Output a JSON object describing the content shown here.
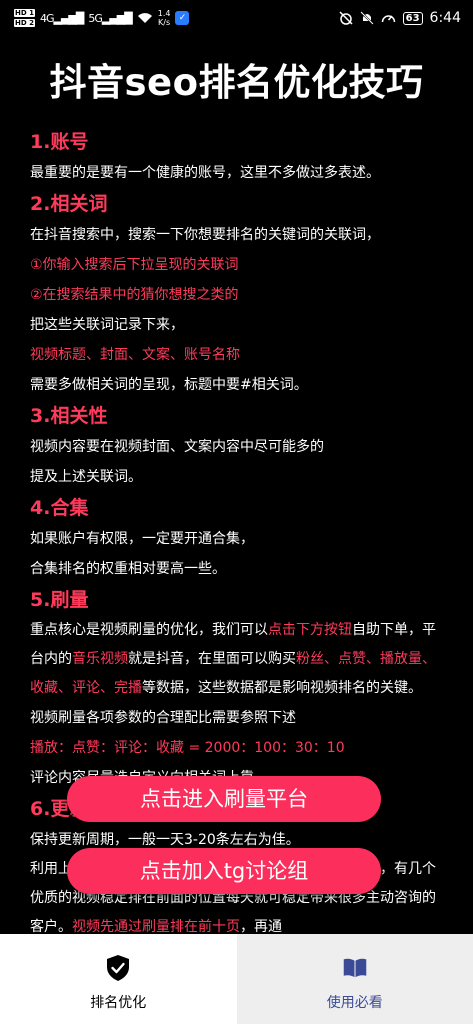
{
  "status_bar": {
    "sim1": "HD 1",
    "sim2": "HD 2",
    "net1": "4G",
    "net2": "5G",
    "speed_value": "1.4",
    "speed_unit": "K/s",
    "battery": "63",
    "time": "6:44"
  },
  "title": "抖音seo排名优化技巧",
  "sections": {
    "s1": {
      "heading": "1.账号",
      "p1": "最重要的是要有一个健康的账号，这里不多做过多表述。"
    },
    "s2": {
      "heading": "2.相关词",
      "p1": "在抖音搜索中，搜索一下你想要排名的关键词的关联词，",
      "p2": "①你输入搜索后下拉呈现的关联词",
      "p3": "②在搜索结果中的猜你想搜之类的",
      "p4": "把这些关联词记录下来，",
      "p5": "视频标题、封面、文案、账号名称",
      "p6": "需要多做相关词的呈现，标题中要#相关词。"
    },
    "s3": {
      "heading": "3.相关性",
      "p1": "视频内容要在视频封面、文案内容中尽可能多的",
      "p2": "提及上述关联词。"
    },
    "s4": {
      "heading": "4.合集",
      "p1": "如果账户有权限，一定要开通合集，",
      "p2": "合集排名的权重相对要高一些。"
    },
    "s5": {
      "heading": "5.刷量",
      "t1": "重点核心是视频刷量的优化，我们可以",
      "t2": "点击下方按钮",
      "t3": "自助下单，平台内的",
      "t4": "音乐视频",
      "t5": "就是抖音，在里面可以购买",
      "t6": "粉丝、点赞、播放量、收藏、评论、完播",
      "t7": "等数据，这些数据都是影响视频排名的关键。",
      "p2": "视频刷量各项参数的合理配比需要参照下述",
      "p3": "播放：点赞：评论：收藏 = 2000：100：30：10",
      "p4": "评论内容尽量选自定义向相关词上靠。"
    },
    "s6": {
      "heading": "6.更新频率",
      "p1": "保持更新周期，一般一天3-20条左右为佳。",
      "t1": "利用上述方法操作后，哪怕你的账号粉丝数量意义并不大，有几个优质的视频稳定排在前面的位置每天就可稳定带来很多主动咨询的客户。",
      "t2": "视频先通过刷量排在前十页",
      "t3": "，再通"
    }
  },
  "buttons": {
    "enter_platform": "点击进入刷量平台",
    "join_tg": "点击加入tg讨论组"
  },
  "tabs": {
    "ranking": "排名优化",
    "guide": "使用必看"
  }
}
